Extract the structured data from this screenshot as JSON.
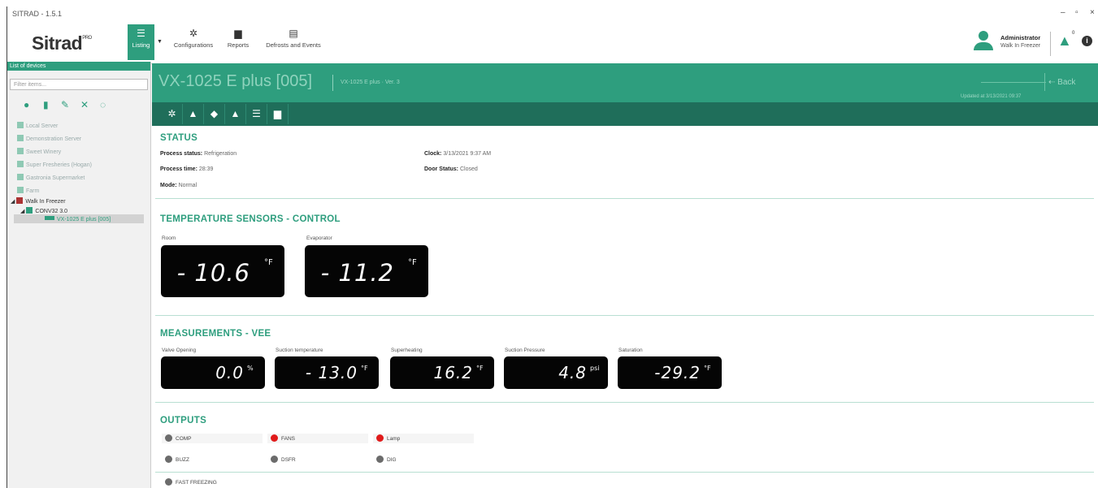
{
  "window": {
    "title": "SITRAD - 1.5.1",
    "controls": [
      "–",
      "▫",
      "×"
    ]
  },
  "toolbar": {
    "logo": "Sitrad",
    "logo_sup": "PRO",
    "listing": "Listing",
    "configurations": "Configurations",
    "reports": "Reports",
    "defrosts": "Defrosts and Events",
    "user_name": "Administrator",
    "user_place": "Walk In Freezer",
    "alarm_count": "0",
    "info": "i"
  },
  "sidebar": {
    "header": "List of devices",
    "filter_placeholder": "Filter items...",
    "tree": [
      "Local Server",
      "Demonstration Server",
      "Sweet Winery",
      "Super Fresheries (Hogan)",
      "Gastronia Supermarket",
      "Farm",
      "Walk In Freezer",
      "CONV32 3.0",
      "VX-1025 E plus [005]"
    ]
  },
  "device": {
    "title": "VX-1025 E plus [005]",
    "subtitle": "VX-1025 E plus · Ver. 3",
    "updated": "Updated at 3/13/2021 09:37",
    "back": "Back"
  },
  "status": {
    "title": "STATUS",
    "process_status_label": "Process status:",
    "process_status": "Refrigeration",
    "process_time_label": "Process time:",
    "process_time": "28:39",
    "mode_label": "Mode:",
    "mode": "Normal",
    "clock_label": "Clock:",
    "clock": "3/13/2021 9:37 AM",
    "door_label": "Door Status:",
    "door": "Closed"
  },
  "temps": {
    "title": "TEMPERATURE SENSORS - CONTROL",
    "room_label": "Room",
    "room_value": "- 10.6",
    "room_unit": "°F",
    "evap_label": "Evaporator",
    "evap_value": "- 11.2",
    "evap_unit": "°F"
  },
  "measurements": {
    "title": "MEASUREMENTS - VEE",
    "items": [
      {
        "label": "Valve Opening",
        "value": "0.0",
        "unit": "%"
      },
      {
        "label": "Suction temperature",
        "value": "- 13.0",
        "unit": "°F"
      },
      {
        "label": "Superheating",
        "value": "16.2",
        "unit": "°F"
      },
      {
        "label": "Suction Pressure",
        "value": "4.8",
        "unit": "psi"
      },
      {
        "label": "Saturation",
        "value": "-29.2",
        "unit": "°F"
      }
    ]
  },
  "outputs": {
    "title": "OUTPUTS",
    "items": [
      {
        "label": "COMP",
        "state": "off"
      },
      {
        "label": "FANS",
        "state": "on"
      },
      {
        "label": "Lamp",
        "state": "on"
      },
      {
        "label": "BUZZ",
        "state": "off"
      },
      {
        "label": "DSFR",
        "state": "off"
      },
      {
        "label": "DIG",
        "state": "off"
      },
      {
        "label": "FAST FREEZING",
        "state": "off"
      }
    ],
    "colors": {
      "on": "#e01b1b",
      "off": "#6b6b6b"
    }
  },
  "colors": {
    "accent": "#2e9e7e",
    "accent_dark": "#1f6e5a"
  }
}
